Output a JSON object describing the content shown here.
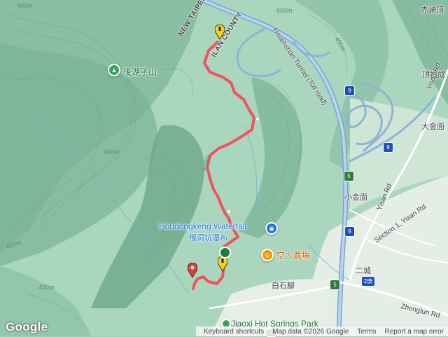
{
  "map": {
    "labels": {
      "county_line_1": "NEW TAIPEI",
      "county_line_2": "ILAN COUNTY",
      "mountain": "後湖子山",
      "tunnel": "Hsuehshan Tunnel (Toll road)",
      "waterfall_en": "Houdongkeng Waterfall",
      "waterfall_zh": "猴洞坑瀑布",
      "farm": "空ㄟ農場",
      "village_shishao": "白石腳",
      "village_xiaojinmian": "小金面",
      "village_dajinmian": "大金面",
      "village_ercheng": "二城",
      "corner_top": "赤崎頂",
      "corner_right": "頂福成",
      "road_yisan_1": "Yisan Rd",
      "road_yisan_2": "Yisan Rd",
      "road_section1": "Section 1, Yisan Rd",
      "road_zhonglun": "Zhonglun Rd",
      "hot_springs": "Jiaoxi Hot Springs Park"
    },
    "contours": [
      "400m",
      "600m",
      "400m",
      "600m",
      "600m",
      "400m",
      "400m"
    ],
    "shields": [
      "9",
      "9",
      "9",
      "5",
      "5",
      "5",
      "2庚"
    ],
    "track_color": "#f2525f",
    "icons": [
      "mountain-icon",
      "camera-icon",
      "restaurant-icon",
      "park-icon",
      "trail-start-icon",
      "trail-end-icon"
    ]
  },
  "footer": {
    "logo": "Google",
    "shortcuts": "Keyboard shortcuts",
    "mapdata": "Map data ©2026 Google",
    "terms": "Terms",
    "report": "Report a map error"
  }
}
